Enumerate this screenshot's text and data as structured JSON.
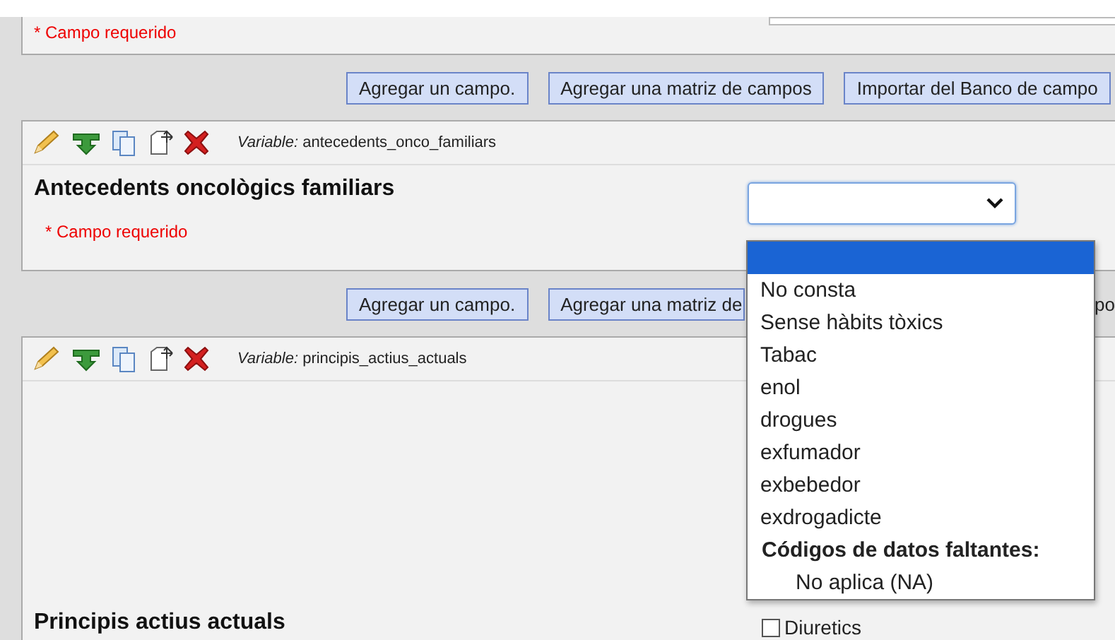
{
  "top_field": {
    "required_note": "* Campo requerido"
  },
  "button_rows": [
    {
      "buttons": [
        "Agregar un campo.",
        "Agregar una matriz de campos",
        "Importar del Banco de campo"
      ]
    },
    {
      "buttons": [
        "Agregar un campo.",
        "Agregar una matriz de"
      ],
      "trailing": "po"
    }
  ],
  "fields": [
    {
      "kind": "select",
      "variable_label": "Variable:",
      "variable": "antecedents_onco_familiars",
      "label": "Antecedents oncològics familiars",
      "required_note": "* Campo requerido"
    },
    {
      "kind": "checkbox",
      "variable_label": "Variable:",
      "variable": "principis_actius_actuals",
      "label": "Principis actius actuals",
      "options": [
        {
          "label": "Diuretics",
          "checked": false
        }
      ]
    }
  ],
  "dropdown": {
    "options": [
      {
        "selected": true
      },
      {
        "label": "No consta",
        "selected": false
      },
      {
        "label": "Sense hàbits tòxics",
        "selected": false
      },
      {
        "label": "Tabac",
        "selected": false
      },
      {
        "label": "enol",
        "selected": false
      },
      {
        "label": "drogues",
        "selected": false
      },
      {
        "label": "exfumador",
        "selected": false
      },
      {
        "label": "exbebedor",
        "selected": false
      },
      {
        "label": "exdrogadicte",
        "selected": false
      }
    ],
    "group": {
      "label": "Códigos de datos faltantes:",
      "options": [
        {
          "label": "No aplica (NA)",
          "selected": false
        }
      ]
    }
  }
}
